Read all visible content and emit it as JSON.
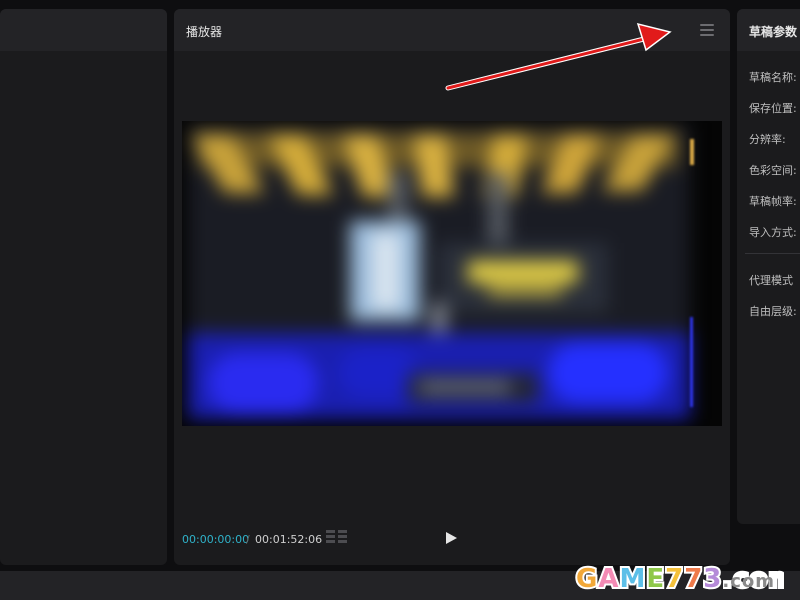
{
  "player": {
    "title": "播放器",
    "menu_icon": "hamburger-menu-icon",
    "timecode_current": "00:00:00:00",
    "timecode_separator": "/",
    "timecode_total": "00:01:52:06",
    "grid_icon": "grid-layout-icon",
    "play_icon": "play-icon"
  },
  "params": {
    "title": "草稿参数",
    "items": [
      {
        "label": "草稿名称:"
      },
      {
        "label": "保存位置:"
      },
      {
        "label": "分辨率:"
      },
      {
        "label": "色彩空间:"
      },
      {
        "label": "草稿帧率:"
      },
      {
        "label": "导入方式:"
      },
      {
        "label": "代理模式"
      },
      {
        "label": "自由层级:"
      }
    ]
  },
  "watermark": {
    "text": "GAME773.com"
  },
  "colors": {
    "accent": "#2fb2c9",
    "arrow": "#e11b1b"
  }
}
